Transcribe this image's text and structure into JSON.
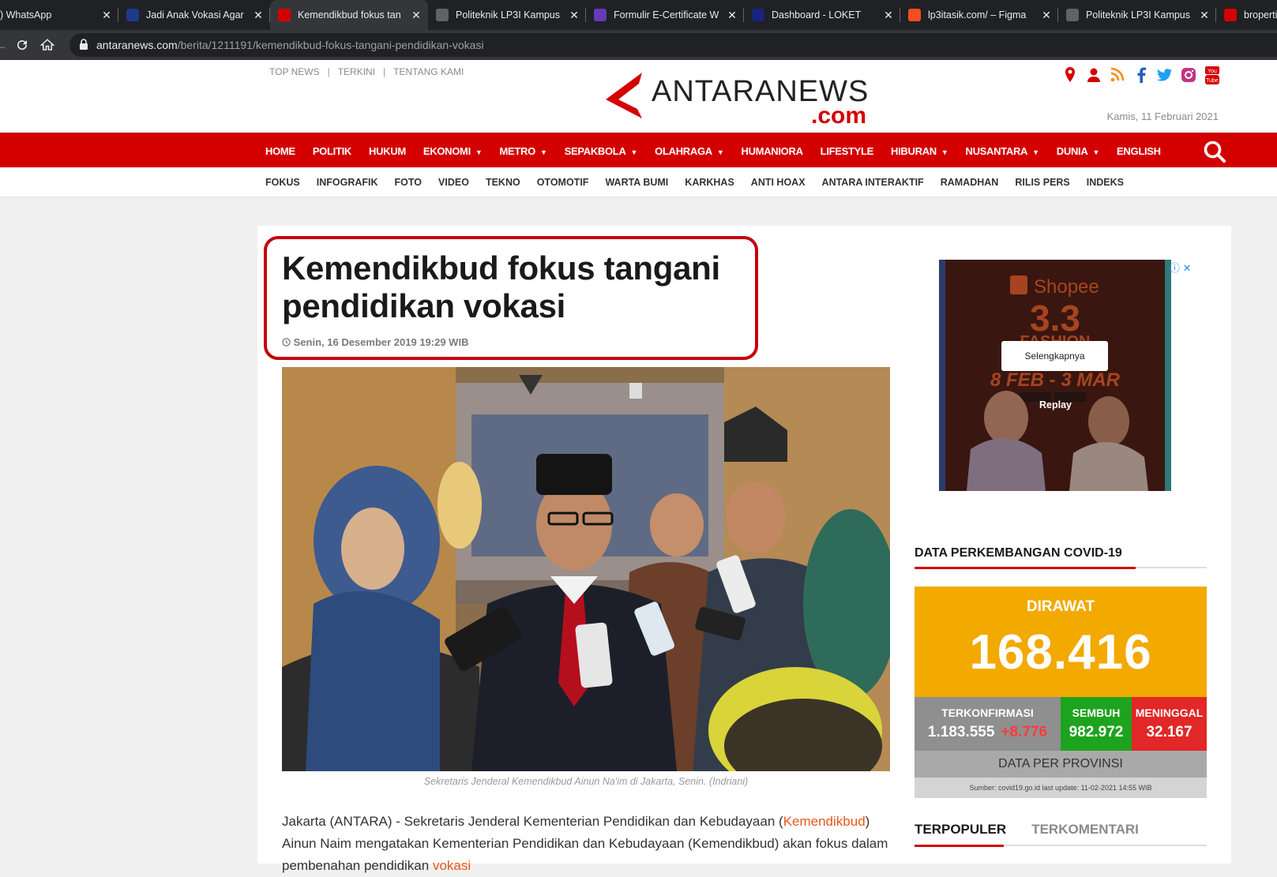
{
  "browser": {
    "tabs": [
      {
        "title": ") WhatsApp",
        "icon": "whatsapp-icon",
        "color": "#202124"
      },
      {
        "title": "Jadi Anak Vokasi Agar E",
        "icon": "w-site-icon",
        "color": "#1e3a8a"
      },
      {
        "title": "Kemendikbud fokus tan",
        "icon": "antara-icon",
        "color": "#d40000",
        "active": true
      },
      {
        "title": "Politeknik LP3I Kampus",
        "icon": "globe-icon",
        "color": "#5f6368"
      },
      {
        "title": "Formulir E-Certificate W",
        "icon": "forms-icon",
        "color": "#673ab7"
      },
      {
        "title": "Dashboard - LOKET",
        "icon": "loket-icon",
        "color": "#1a237e"
      },
      {
        "title": "lp3itasik.com/ – Figma",
        "icon": "figma-icon",
        "color": "#f24e1e"
      },
      {
        "title": "Politeknik LP3I Kampus",
        "icon": "globe-icon",
        "color": "#5f6368"
      },
      {
        "title": "broperti",
        "icon": "broperti-icon",
        "color": "#d40000"
      }
    ],
    "url_host": "antaranews.com",
    "url_path": "/berita/1211191/kemendikbud-fokus-tangani-pendidikan-vokasi"
  },
  "site": {
    "top_links": [
      "TOP NEWS",
      "TERKINI",
      "TENTANG KAMI"
    ],
    "logo_text": "ANTARANEWS",
    "logo_suffix": ".com",
    "date": "Kamis, 11 Februari 2021",
    "social_icons": [
      "location-icon",
      "user-icon",
      "rss-icon",
      "facebook-icon",
      "twitter-icon",
      "instagram-icon",
      "youtube-icon"
    ]
  },
  "nav": {
    "main": [
      {
        "label": "HOME",
        "caret": false
      },
      {
        "label": "POLITIK",
        "caret": false
      },
      {
        "label": "HUKUM",
        "caret": false
      },
      {
        "label": "EKONOMI",
        "caret": true
      },
      {
        "label": "METRO",
        "caret": true
      },
      {
        "label": "SEPAKBOLA",
        "caret": true
      },
      {
        "label": "OLAHRAGA",
        "caret": true
      },
      {
        "label": "HUMANIORA",
        "caret": false
      },
      {
        "label": "LIFESTYLE",
        "caret": false
      },
      {
        "label": "HIBURAN",
        "caret": true
      },
      {
        "label": "NUSANTARA",
        "caret": true
      },
      {
        "label": "DUNIA",
        "caret": true
      },
      {
        "label": "ENGLISH",
        "caret": false
      }
    ],
    "sub": [
      "FOKUS",
      "INFOGRAFIK",
      "FOTO",
      "VIDEO",
      "TEKNO",
      "OTOMOTIF",
      "WARTA BUMI",
      "KARKHAS",
      "ANTI HOAX",
      "ANTARA INTERAKTIF",
      "RAMADHAN",
      "RILIS PERS",
      "INDEKS"
    ]
  },
  "article": {
    "headline": "Kemendikbud fokus tangani pendidikan vokasi",
    "date": "Senin, 16 Desember 2019 19:29 WIB",
    "caption": "Sekretaris Jenderal Kemendikbud Ainun Na'im di Jakarta, Senin. (Indriani)",
    "body_prefix": "Jakarta (ANTARA) - Sekretaris Jenderal Kementerian Pendidikan dan Kebudayaan (",
    "body_link1": "Kemendikbud",
    "body_mid": ") Ainun Naim mengatakan Kementerian Pendidikan dan Kebudayaan (Kemendikbud) akan fokus dalam pembenahan pendidikan ",
    "body_link2": "vokasi"
  },
  "ad": {
    "brand": "Shopee",
    "headline": "3.3",
    "sub1": "FASHION",
    "sub2": "8 FEB - 3 MAR",
    "button": "Selengkapnya",
    "replay": "Replay"
  },
  "covid": {
    "title": "DATA PERKEMBANGAN COVID-19",
    "dirawat_label": "DIRAWAT",
    "dirawat_value": "168.416",
    "terkonfirmasi_label": "TERKONFIRMASI",
    "terkonfirmasi_value": "1.183.555",
    "terkonfirmasi_increase": "+8.776",
    "sembuh_label": "SEMBUH",
    "sembuh_value": "982.972",
    "meninggal_label": "MENINGGAL",
    "meninggal_value": "32.167",
    "provinsi_button": "DATA PER PROVINSI",
    "source": "Sumber: covid19.go.id last update: 11-02-2021 14:55 WIB"
  },
  "popular_tabs": [
    "TERPOPULER",
    "TERKOMENTARI"
  ],
  "colors": {
    "brand_red": "#d40000",
    "dirawat": "#f2a900",
    "sembuh": "#1ea31e",
    "meninggal": "#e12727",
    "link_orange": "#e8571a"
  }
}
